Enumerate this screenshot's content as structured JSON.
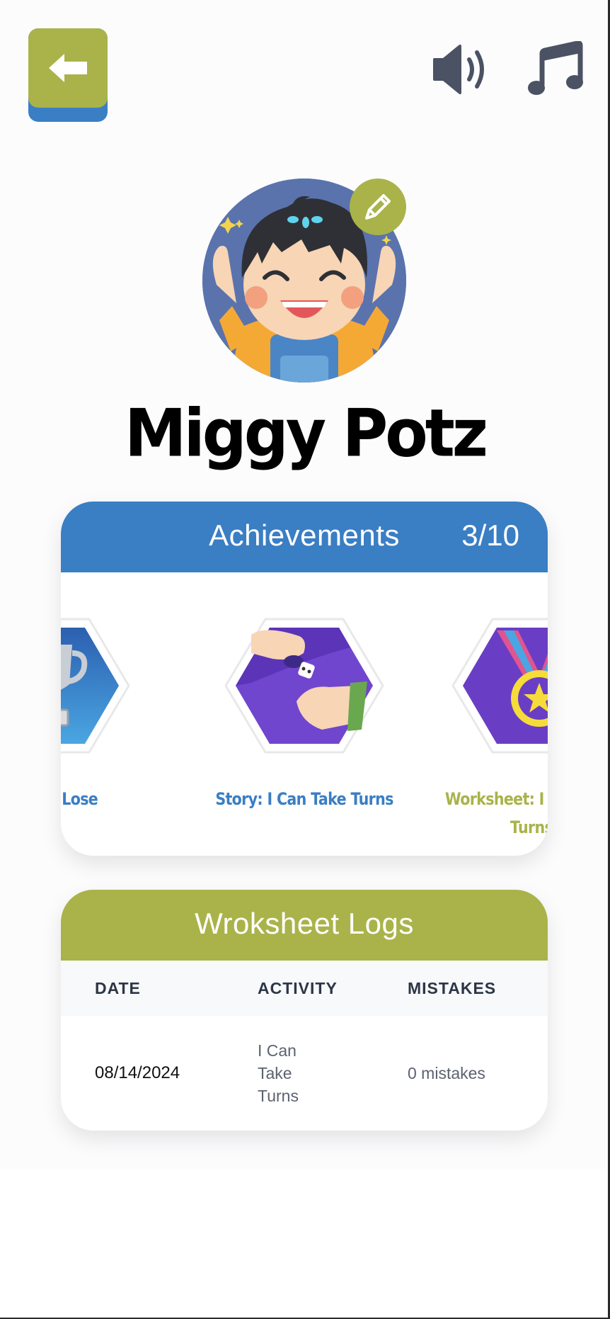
{
  "header": {
    "back_icon": "arrow-left-icon",
    "sound_icon": "speaker-volume-icon",
    "music_icon": "music-note-icon"
  },
  "profile": {
    "name": "Miggy Potz",
    "edit_icon": "pencil-icon"
  },
  "achievements": {
    "title": "Achievements",
    "count": "3/10",
    "items": [
      {
        "label": "When I Lose",
        "icon": "trophy-icon",
        "color": "#3a7ec4"
      },
      {
        "label": "Story: I Can Take Turns",
        "icon": "dice-hands-icon",
        "color": "#3a7ec4"
      },
      {
        "label": "Worksheet: I Can Take Turns",
        "icon": "medal-icon",
        "color": "#a9b34a"
      }
    ]
  },
  "worksheet_logs": {
    "title": "Wroksheet Logs",
    "columns": [
      "DATE",
      "ACTIVITY",
      "MISTAKES"
    ],
    "rows": [
      {
        "date": "08/14/2024",
        "activity": "I Can Take Turns",
        "mistakes": "0 mistakes"
      }
    ]
  },
  "colors": {
    "blue": "#3a7ec4",
    "olive": "#a9b34a",
    "icon_gray": "#4a5263"
  }
}
